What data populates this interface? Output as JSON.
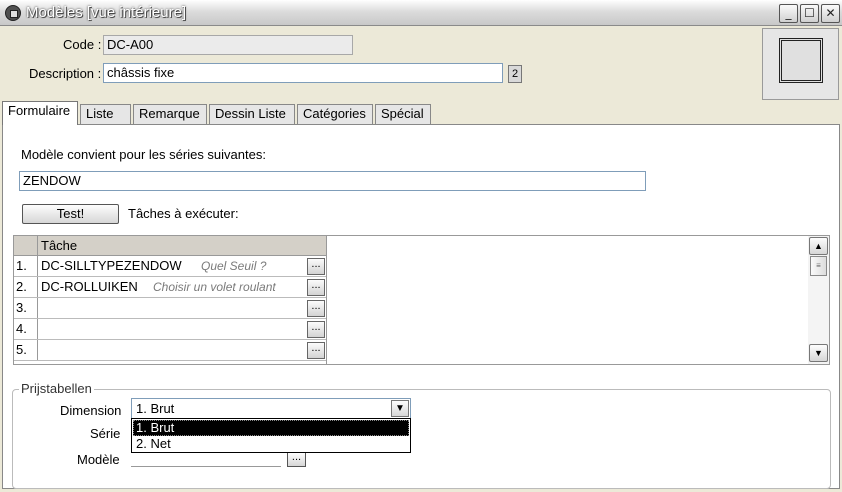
{
  "window": {
    "title": "Modèles [vue intérieure]",
    "controls": {
      "minimize": "_",
      "maximize": "☐",
      "close": "✕"
    }
  },
  "header": {
    "code_label": "Code :",
    "code_value": "DC-A00",
    "description_label": "Description :",
    "description_value": "châssis fixe",
    "description_badge": "2"
  },
  "tabs": [
    "Formulaire",
    "Liste",
    "Remarque",
    "Dessin Liste",
    "Catégories",
    "Spécial"
  ],
  "form": {
    "series_label": "Modèle convient pour les séries suivantes:",
    "series_value": "ZENDOW",
    "test_button": "Test!",
    "tasks_label": "Tâches à exécuter:"
  },
  "grid": {
    "column_header": "Tâche",
    "rows": [
      {
        "num": "1.",
        "code": "DC-SILLTYPEZENDOW",
        "hint": "Quel Seuil ?"
      },
      {
        "num": "2.",
        "code": "DC-ROLLUIKEN",
        "hint": "Choisir un volet roulant"
      },
      {
        "num": "3.",
        "code": "",
        "hint": ""
      },
      {
        "num": "4.",
        "code": "",
        "hint": ""
      },
      {
        "num": "5.",
        "code": "",
        "hint": ""
      }
    ],
    "dots_label": "...",
    "scroll_up": "▲",
    "scroll_down": "▼",
    "thumb_grip": "≡"
  },
  "pricing": {
    "legend": "Prijstabellen",
    "dimension_label": "Dimension",
    "dimension_value": "1.  Brut",
    "dropdown_arrow": "▼",
    "options": [
      "1.  Brut",
      "2.  Net"
    ],
    "serie_label": "Série",
    "modele_label": "Modèle",
    "modele_button": "..."
  }
}
